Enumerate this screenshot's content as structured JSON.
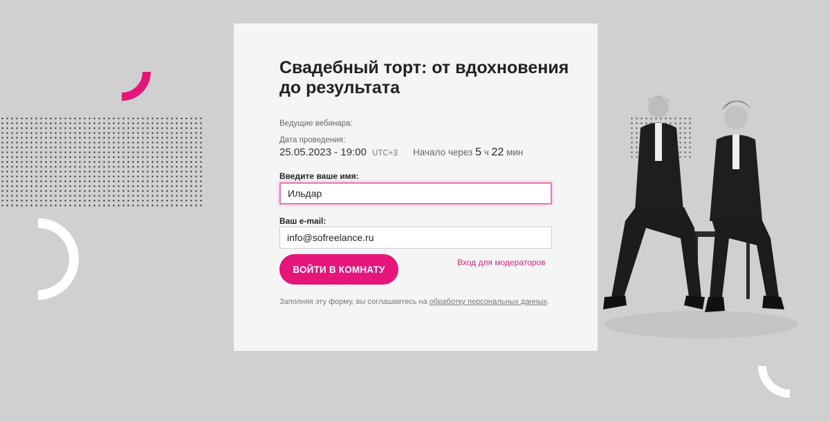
{
  "webinar": {
    "title": "Свадебный торт: от вдохновения до результата",
    "hosts_label": "Ведущие вебинара:",
    "date_label": "Дата проведения:",
    "date_value": "25.05.2023 - 19:00",
    "timezone": "UTC+3",
    "starts_in_label": "Начало через",
    "hours_value": "5",
    "hours_unit": "ч",
    "minutes_value": "22",
    "minutes_unit": "мин"
  },
  "form": {
    "name_label": "Введите ваше имя:",
    "name_value": "Ильдар",
    "email_label": "Ваш e-mail:",
    "email_value": "info@sofreelance.ru",
    "submit_label": "ВОЙТИ В КОМНАТУ",
    "moderator_link": "Вход для модераторов",
    "consent_text": "Заполняя эту форму, вы соглашаетесь на ",
    "consent_link": "обработку персональных данных",
    "consent_end": "."
  },
  "colors": {
    "accent": "#e5157a",
    "background": "#d0d0d0",
    "card": "#f5f5f5"
  },
  "decor": {
    "icons": [
      "pink-arc-icon",
      "white-ring-icon",
      "white-arc-icon",
      "dot-grid"
    ]
  }
}
